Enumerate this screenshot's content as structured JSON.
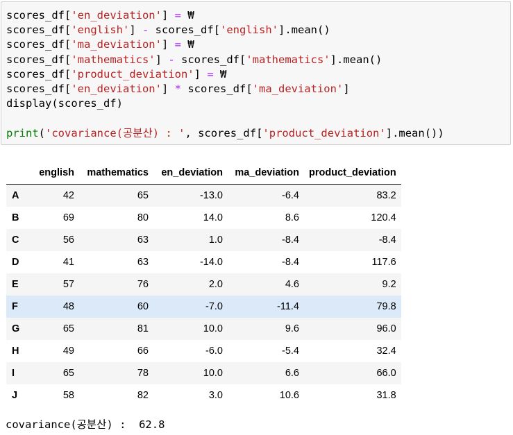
{
  "code_lines": [
    [
      {
        "t": "scores_df["
      },
      {
        "t": "'en_deviation'",
        "c": "str"
      },
      {
        "t": "] "
      },
      {
        "t": "=",
        "c": "op"
      },
      {
        "t": " ₩"
      }
    ],
    [
      {
        "t": "scores_df["
      },
      {
        "t": "'english'",
        "c": "str"
      },
      {
        "t": "] "
      },
      {
        "t": "-",
        "c": "op"
      },
      {
        "t": " scores_df["
      },
      {
        "t": "'english'",
        "c": "str"
      },
      {
        "t": "].mean()"
      }
    ],
    [
      {
        "t": "scores_df["
      },
      {
        "t": "'ma_deviation'",
        "c": "str"
      },
      {
        "t": "] "
      },
      {
        "t": "=",
        "c": "op"
      },
      {
        "t": " ₩"
      }
    ],
    [
      {
        "t": "scores_df["
      },
      {
        "t": "'mathematics'",
        "c": "str"
      },
      {
        "t": "] "
      },
      {
        "t": "-",
        "c": "op"
      },
      {
        "t": " scores_df["
      },
      {
        "t": "'mathematics'",
        "c": "str"
      },
      {
        "t": "].mean()"
      }
    ],
    [
      {
        "t": "scores_df["
      },
      {
        "t": "'product_deviation'",
        "c": "str"
      },
      {
        "t": "] "
      },
      {
        "t": "=",
        "c": "op"
      },
      {
        "t": " ₩"
      }
    ],
    [
      {
        "t": "scores_df["
      },
      {
        "t": "'en_deviation'",
        "c": "str"
      },
      {
        "t": "] "
      },
      {
        "t": "*",
        "c": "op"
      },
      {
        "t": " scores_df["
      },
      {
        "t": "'ma_deviation'",
        "c": "str"
      },
      {
        "t": "]"
      }
    ],
    [
      {
        "t": "display(scores_df)"
      }
    ],
    [],
    [
      {
        "t": "print",
        "c": "kw"
      },
      {
        "t": "("
      },
      {
        "t": "'covariance(공분산) : '",
        "c": "str"
      },
      {
        "t": ", scores_df["
      },
      {
        "t": "'product_deviation'",
        "c": "str"
      },
      {
        "t": "].mean())"
      }
    ]
  ],
  "table": {
    "columns": [
      "english",
      "mathematics",
      "en_deviation",
      "ma_deviation",
      "product_deviation"
    ],
    "rows": [
      {
        "index": "A",
        "values": [
          "42",
          "65",
          "-13.0",
          "-6.4",
          "83.2"
        ]
      },
      {
        "index": "B",
        "values": [
          "69",
          "80",
          "14.0",
          "8.6",
          "120.4"
        ]
      },
      {
        "index": "C",
        "values": [
          "56",
          "63",
          "1.0",
          "-8.4",
          "-8.4"
        ]
      },
      {
        "index": "D",
        "values": [
          "41",
          "63",
          "-14.0",
          "-8.4",
          "117.6"
        ]
      },
      {
        "index": "E",
        "values": [
          "57",
          "76",
          "2.0",
          "4.6",
          "9.2"
        ]
      },
      {
        "index": "F",
        "values": [
          "48",
          "60",
          "-7.0",
          "-11.4",
          "79.8"
        ]
      },
      {
        "index": "G",
        "values": [
          "65",
          "81",
          "10.0",
          "9.6",
          "96.0"
        ]
      },
      {
        "index": "H",
        "values": [
          "49",
          "66",
          "-6.0",
          "-5.4",
          "32.4"
        ]
      },
      {
        "index": "I",
        "values": [
          "65",
          "78",
          "10.0",
          "6.6",
          "66.0"
        ]
      },
      {
        "index": "J",
        "values": [
          "58",
          "82",
          "3.0",
          "10.6",
          "31.8"
        ]
      }
    ],
    "hover_row": 5
  },
  "print_output": "covariance(공분산) :  62.8"
}
